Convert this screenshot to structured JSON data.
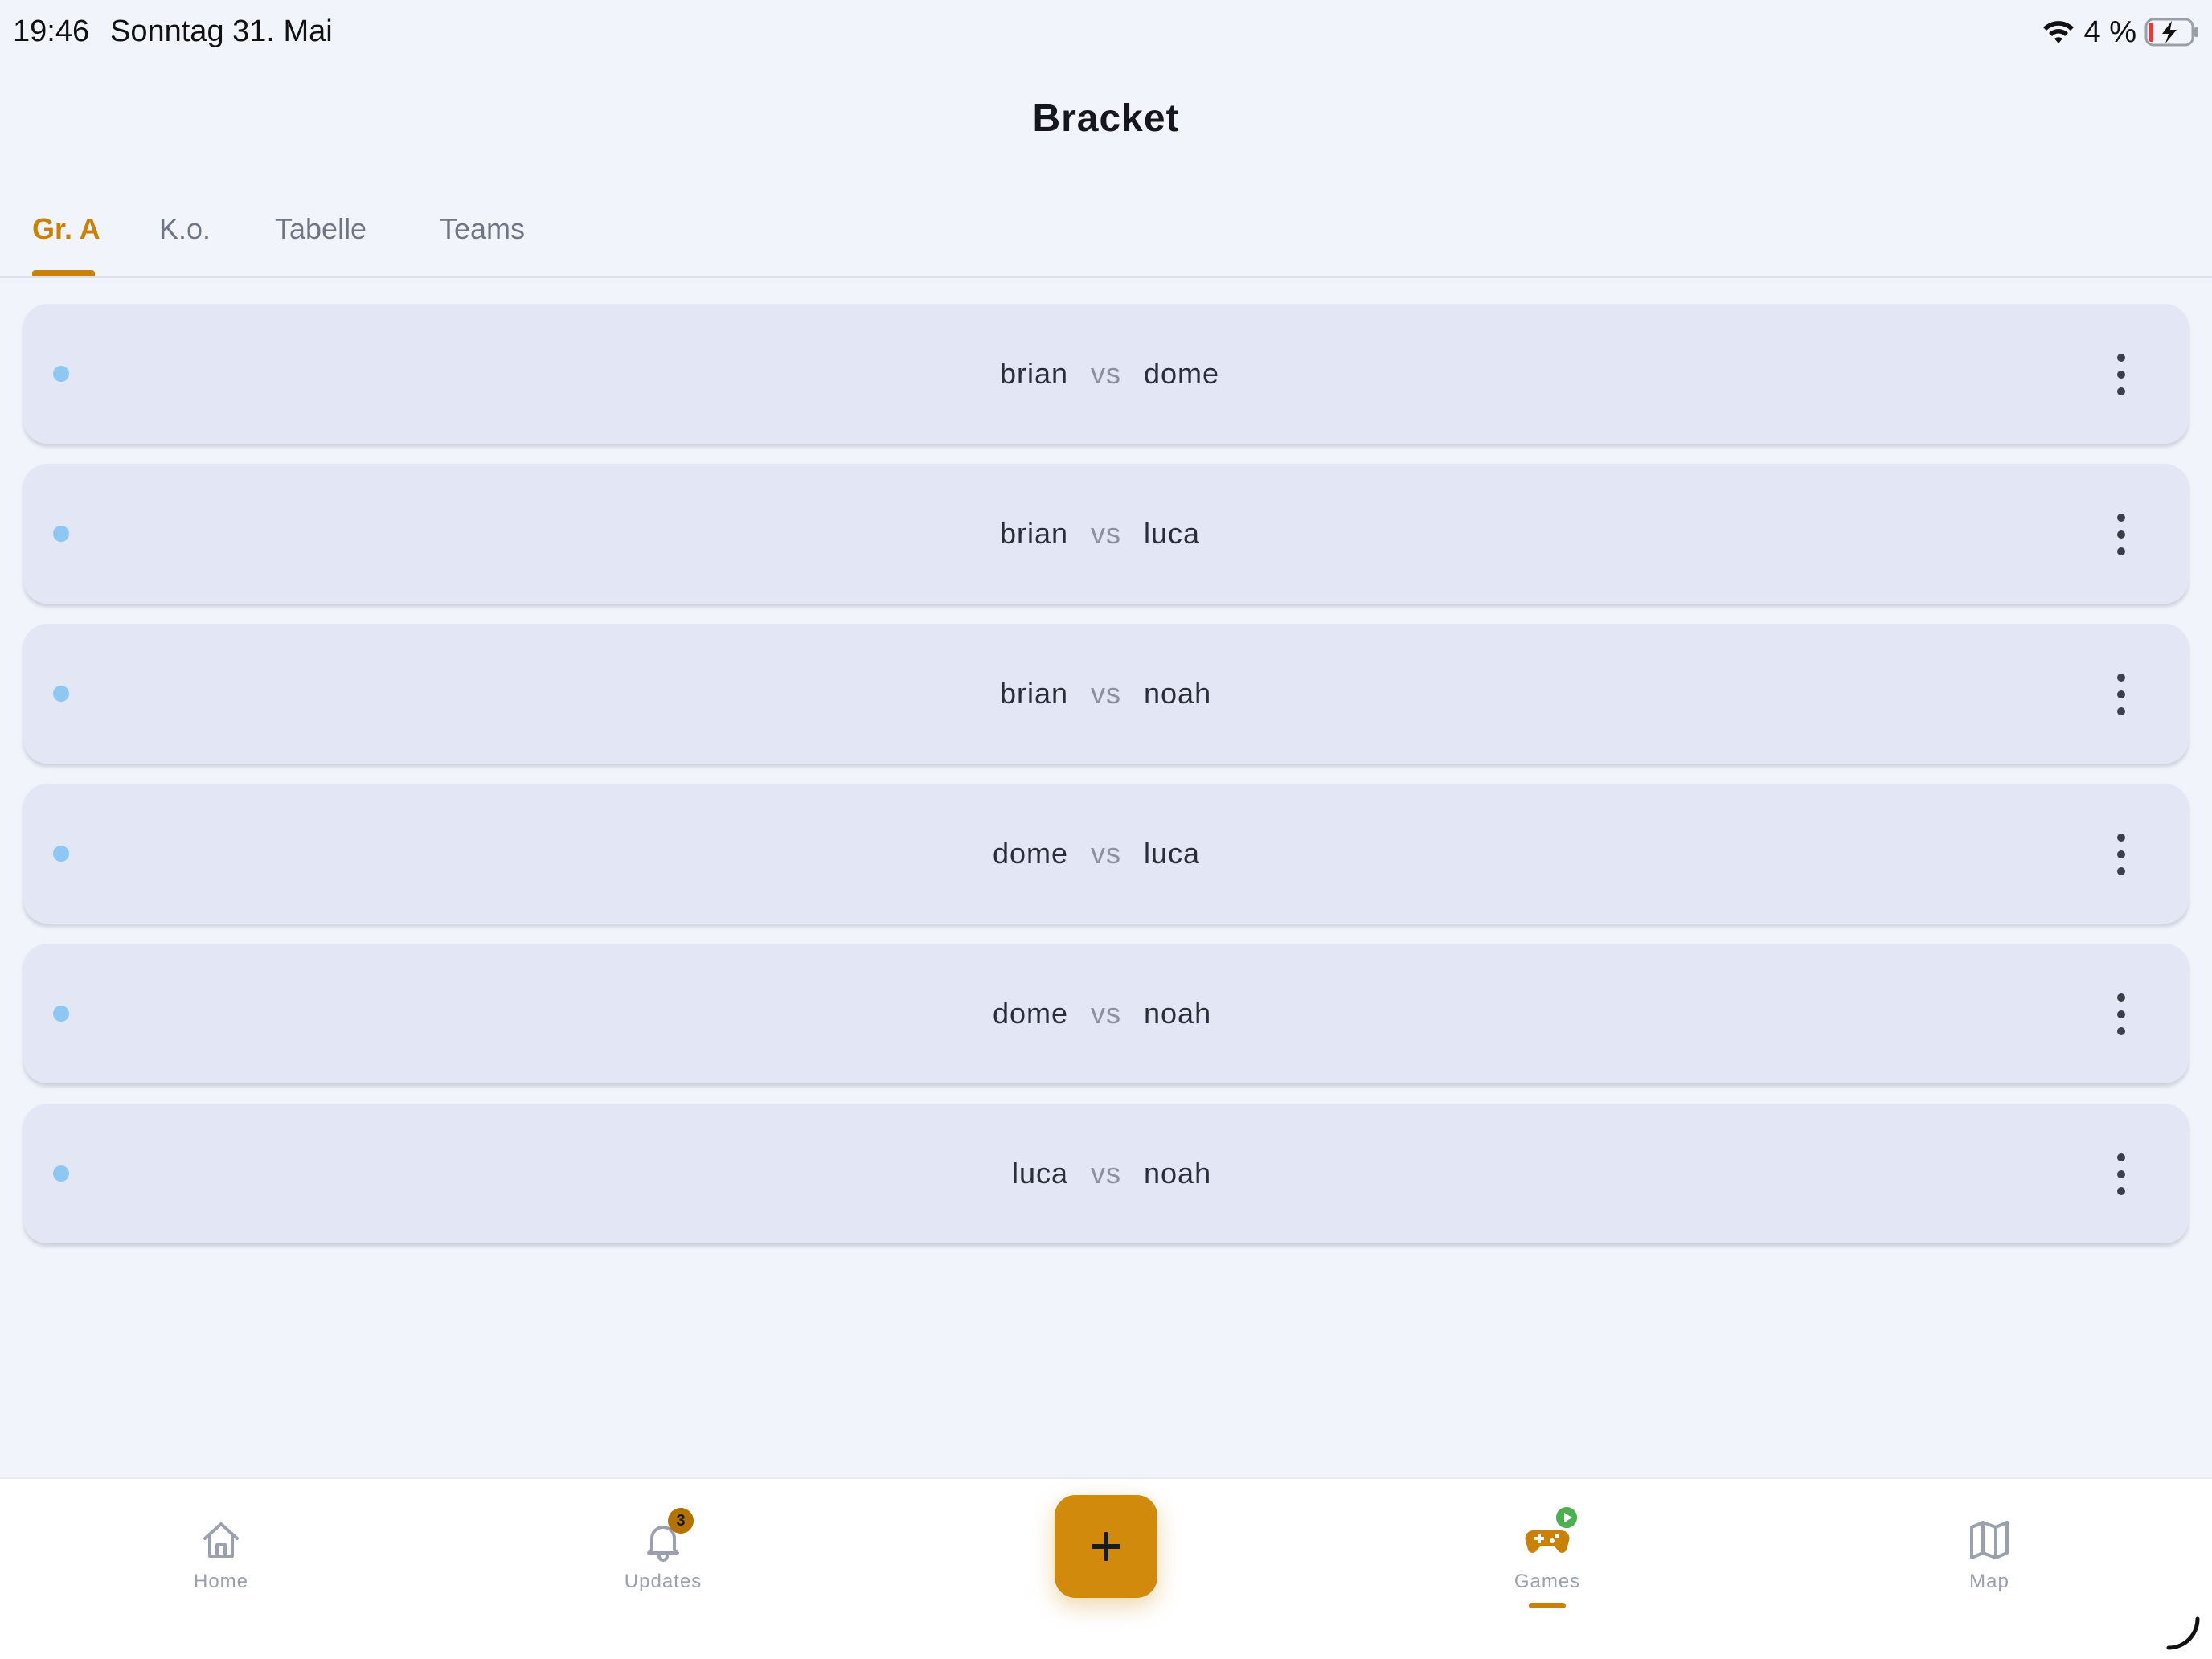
{
  "status_bar": {
    "time": "19:46",
    "date": "Sonntag 31. Mai",
    "battery_text": "4 %",
    "icons": [
      "wifi-icon",
      "battery-charging-icon"
    ]
  },
  "header": {
    "title": "Bracket"
  },
  "tabs": [
    {
      "label": "Gr. A",
      "active": true
    },
    {
      "label": "K.o.",
      "active": false
    },
    {
      "label": "Tabelle",
      "active": false
    },
    {
      "label": "Teams",
      "active": false
    }
  ],
  "matches": [
    {
      "home": "brian",
      "vs": "vs",
      "away": "dome"
    },
    {
      "home": "brian",
      "vs": "vs",
      "away": "luca"
    },
    {
      "home": "brian",
      "vs": "vs",
      "away": "noah"
    },
    {
      "home": "dome",
      "vs": "vs",
      "away": "luca"
    },
    {
      "home": "dome",
      "vs": "vs",
      "away": "noah"
    },
    {
      "home": "luca",
      "vs": "vs",
      "away": "noah"
    }
  ],
  "bottom_nav": {
    "items": [
      {
        "label": "Home",
        "icon": "home-icon",
        "active": false
      },
      {
        "label": "Updates",
        "icon": "bell-icon",
        "badge": "3",
        "active": false
      },
      {
        "label": "Games",
        "icon": "gamepad-icon",
        "active": true
      },
      {
        "label": "Map",
        "icon": "map-icon",
        "active": false
      }
    ],
    "fab_icon": "plus-icon"
  },
  "colors": {
    "accent": "#c98207",
    "fab": "#d18a0c",
    "background": "#f1f4fb",
    "card": "#e3e7f5",
    "status_dot": "#8ec8f2",
    "live_badge": "#4caf50"
  }
}
